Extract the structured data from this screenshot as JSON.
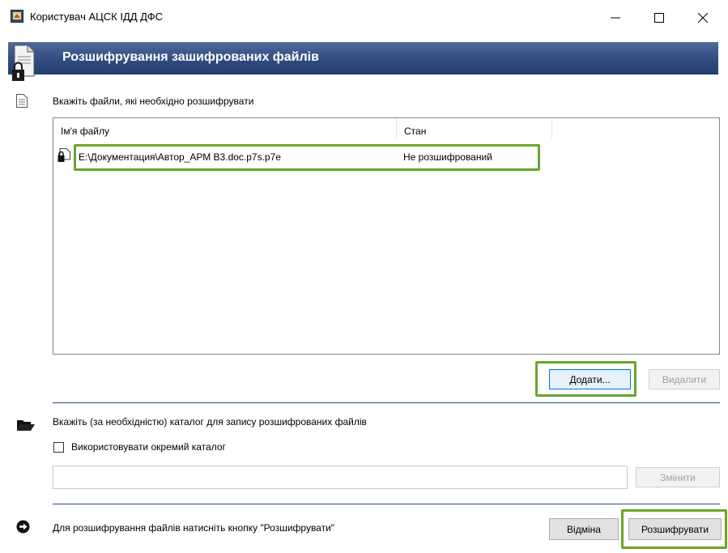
{
  "window": {
    "title": "Користувач АЦСК ІДД ДФС",
    "minimize_glyph": "—",
    "maximize_glyph": "☐",
    "close_glyph": "✕"
  },
  "header": {
    "title": "Розшифрування зашифрованих файлів"
  },
  "files_section": {
    "label": "Вкажіть файли, які необхідно розшифрувати",
    "columns": [
      "Ім'я файлу",
      "Стан"
    ],
    "rows": [
      {
        "name": "E:\\Документация\\Автор_АРМ В3.doc.p7s.p7e",
        "state": "Не розшифрований"
      }
    ],
    "add_button": "Додати...",
    "remove_button": "Видалити"
  },
  "folder_section": {
    "label": "Вкажіть (за необхідністю) каталог для запису розшифрованих файлів",
    "checkbox_label": "Використовувати окремий каталог",
    "checkbox_checked": false,
    "path_value": "",
    "change_button": "Змінити"
  },
  "footer": {
    "hint": "Для розшифрування файлів натисніть кнопку \"Розшифрувати\"",
    "cancel_button": "Відміна",
    "decrypt_button": "Розшифрувати"
  },
  "colors": {
    "header": "#2e4a7e",
    "highlight": "#6aa52e",
    "focus": "#0078d7"
  }
}
